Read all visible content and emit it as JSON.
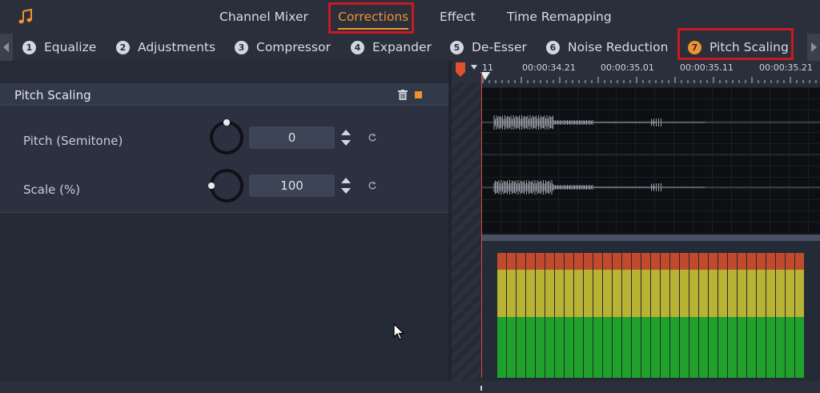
{
  "top_tabs": [
    {
      "label": "Channel Mixer",
      "active": false
    },
    {
      "label": "Corrections",
      "active": true
    },
    {
      "label": "Effect",
      "active": false
    },
    {
      "label": "Time Remapping",
      "active": false
    }
  ],
  "sub_tabs": [
    {
      "number": "1",
      "label": "Equalize"
    },
    {
      "number": "2",
      "label": "Adjustments"
    },
    {
      "number": "3",
      "label": "Compressor"
    },
    {
      "number": "4",
      "label": "Expander"
    },
    {
      "number": "5",
      "label": "De-Esser"
    },
    {
      "number": "6",
      "label": "Noise Reduction"
    },
    {
      "number": "7",
      "label": "Pitch Scaling",
      "active": true
    }
  ],
  "section": {
    "title": "Pitch Scaling"
  },
  "params": [
    {
      "label": "Pitch (Semitone)",
      "value": "0"
    },
    {
      "label": "Scale (%)",
      "value": "100"
    }
  ],
  "timeline": {
    "ruler_labels": [
      "11",
      "00:00:34.21",
      "00:00:35.01",
      "00:00:35.11",
      "00:00:35.21"
    ]
  },
  "colors": {
    "accent": "#f0922e",
    "highlight_box": "#c81a1f",
    "meter_green": "#1fa12b",
    "meter_yellow": "#b9b334",
    "meter_red": "#c24a2c"
  },
  "icons": {
    "app": "music-note-icon",
    "delete": "trash-icon",
    "reset": "reset-icon"
  }
}
